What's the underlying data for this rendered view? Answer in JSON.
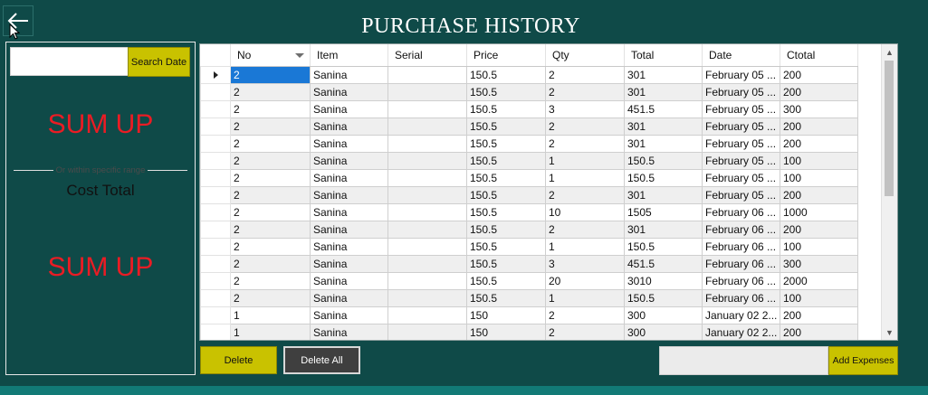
{
  "header": {
    "title": "PURCHASE HISTORY",
    "back_icon": "arrow-left-icon"
  },
  "left_panel": {
    "search_placeholder": "",
    "search_button": "Search Date",
    "sum_up_top": "SUM UP",
    "range_label": "Or within specific range",
    "cost_total_label": "Cost Total",
    "sum_up_bottom": "SUM UP"
  },
  "grid": {
    "columns": [
      "No",
      "Item",
      "Serial",
      "Price",
      "Qty",
      "Total",
      "Date",
      "Ctotal"
    ],
    "rows": [
      {
        "no": "2",
        "item": "Sanina",
        "serial": "",
        "price": "150.5",
        "qty": "2",
        "total": "301",
        "date": "February 05 ...",
        "ctotal": "200"
      },
      {
        "no": "2",
        "item": "Sanina",
        "serial": "",
        "price": "150.5",
        "qty": "2",
        "total": "301",
        "date": "February 05 ...",
        "ctotal": "200"
      },
      {
        "no": "2",
        "item": "Sanina",
        "serial": "",
        "price": "150.5",
        "qty": "3",
        "total": "451.5",
        "date": "February 05 ...",
        "ctotal": "300"
      },
      {
        "no": "2",
        "item": "Sanina",
        "serial": "",
        "price": "150.5",
        "qty": "2",
        "total": "301",
        "date": "February 05 ...",
        "ctotal": "200"
      },
      {
        "no": "2",
        "item": "Sanina",
        "serial": "",
        "price": "150.5",
        "qty": "2",
        "total": "301",
        "date": "February 05 ...",
        "ctotal": "200"
      },
      {
        "no": "2",
        "item": "Sanina",
        "serial": "",
        "price": "150.5",
        "qty": "1",
        "total": "150.5",
        "date": "February 05 ...",
        "ctotal": "100"
      },
      {
        "no": "2",
        "item": "Sanina",
        "serial": "",
        "price": "150.5",
        "qty": "1",
        "total": "150.5",
        "date": "February 05 ...",
        "ctotal": "100"
      },
      {
        "no": "2",
        "item": "Sanina",
        "serial": "",
        "price": "150.5",
        "qty": "2",
        "total": "301",
        "date": "February 05 ...",
        "ctotal": "200"
      },
      {
        "no": "2",
        "item": "Sanina",
        "serial": "",
        "price": "150.5",
        "qty": "10",
        "total": "1505",
        "date": "February 06 ...",
        "ctotal": "1000"
      },
      {
        "no": "2",
        "item": "Sanina",
        "serial": "",
        "price": "150.5",
        "qty": "2",
        "total": "301",
        "date": "February 06 ...",
        "ctotal": "200"
      },
      {
        "no": "2",
        "item": "Sanina",
        "serial": "",
        "price": "150.5",
        "qty": "1",
        "total": "150.5",
        "date": "February 06 ...",
        "ctotal": "100"
      },
      {
        "no": "2",
        "item": "Sanina",
        "serial": "",
        "price": "150.5",
        "qty": "3",
        "total": "451.5",
        "date": "February 06 ...",
        "ctotal": "300"
      },
      {
        "no": "2",
        "item": "Sanina",
        "serial": "",
        "price": "150.5",
        "qty": "20",
        "total": "3010",
        "date": "February 06 ...",
        "ctotal": "2000"
      },
      {
        "no": "2",
        "item": "Sanina",
        "serial": "",
        "price": "150.5",
        "qty": "1",
        "total": "150.5",
        "date": "February 06 ...",
        "ctotal": "100"
      },
      {
        "no": "1",
        "item": "Sanina",
        "serial": "",
        "price": "150",
        "qty": "2",
        "total": "300",
        "date": "January 02 2...",
        "ctotal": "200"
      },
      {
        "no": "1",
        "item": "Sanina",
        "serial": "",
        "price": "150",
        "qty": "2",
        "total": "300",
        "date": "January 02 2...",
        "ctotal": "200"
      }
    ]
  },
  "footer": {
    "delete_button": "Delete",
    "delete_all_button": "Delete All",
    "expense_value": "",
    "add_expenses_button": "Add Expenses"
  },
  "colors": {
    "background": "#0f4a48",
    "accent_button": "#c9c200",
    "sum_up_text": "#ea1c24",
    "selected_cell": "#1a78d6"
  }
}
